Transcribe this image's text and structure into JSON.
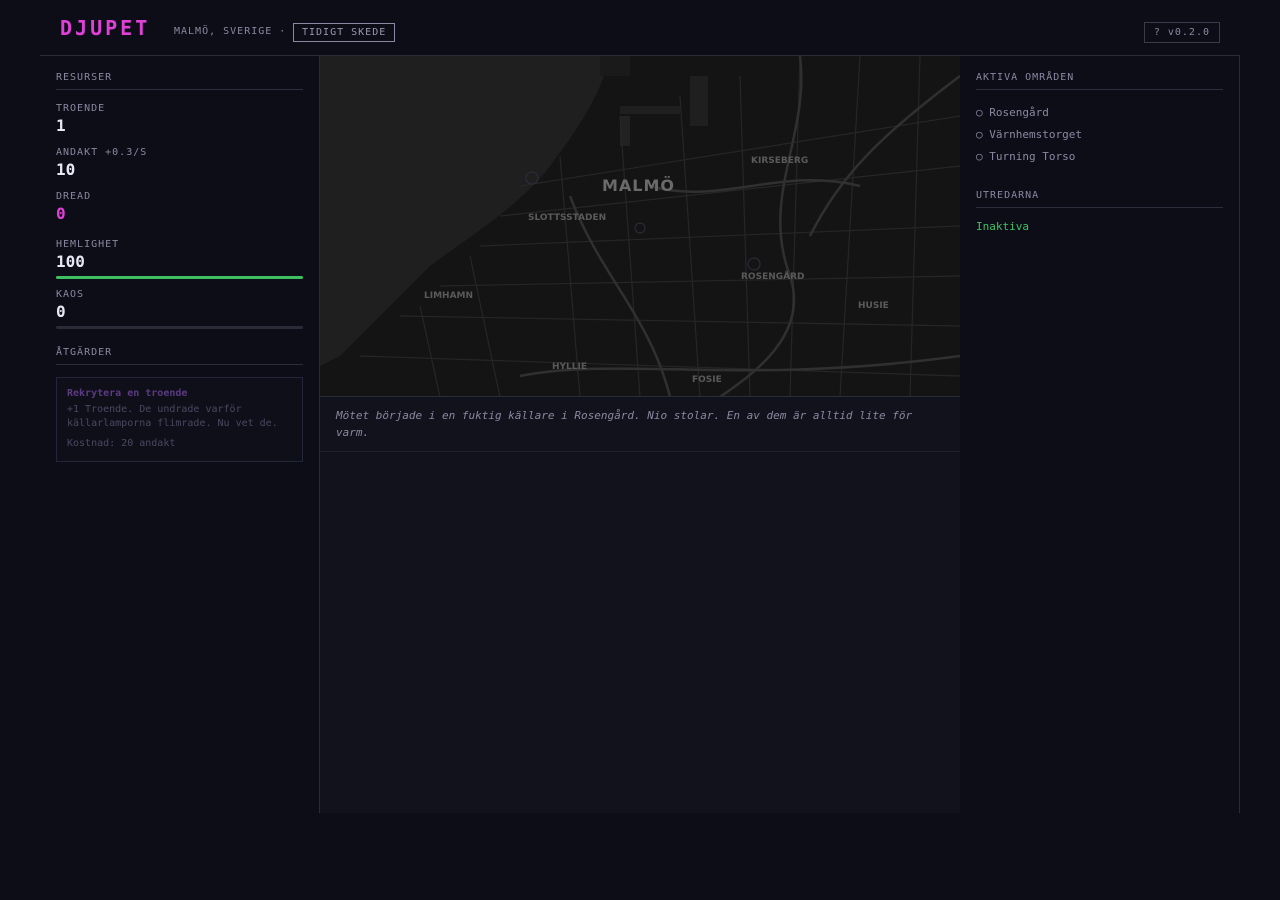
{
  "header": {
    "title": "DJUPET",
    "location": "MALMÖ, SVERIGE ·",
    "phase": "TIDIGT SKEDE",
    "version_button": "? v0.2.0"
  },
  "resources": {
    "title": "RESURSER",
    "troende": {
      "label": "TROENDE",
      "value": "1"
    },
    "andakt": {
      "label": "ANDAKT +0.3/S",
      "value": "10"
    },
    "dread": {
      "label": "DREAD",
      "value": "0"
    },
    "hemlighet": {
      "label": "HEMLIGHET",
      "value": "100",
      "bar_percent": 100
    },
    "kaos": {
      "label": "KAOS",
      "value": "0",
      "bar_percent": 0
    }
  },
  "actions": {
    "title": "ÅTGÄRDER",
    "items": [
      {
        "name": "Rekrytera en troende",
        "description": "+1 Troende. De undrade varför källarlamporna flimrade. Nu vet de.",
        "cost": "Kostnad: 20 andakt"
      }
    ]
  },
  "map": {
    "labels": {
      "malmo": "MALMÖ",
      "kirseberg": "KIRSEBERG",
      "slottsstaden": "SLOTTSSTADEN",
      "rosengard": "ROSENGÅRD",
      "limhamn": "LIMHAMN",
      "husie": "HUSIE",
      "hyllie": "HYLLIE",
      "fosie": "FOSIE"
    }
  },
  "log": {
    "entries": [
      "Mötet började i en fuktig källare i Rosengård. Nio stolar. En av dem är alltid lite för varm."
    ]
  },
  "areas": {
    "title": "AKTIVA OMRÅDEN",
    "items": [
      "○ Rosengård",
      "○ Värnhemstorget",
      "○ Turning Torso"
    ]
  },
  "investigators": {
    "title": "UTREDARNA",
    "status": "Inaktiva"
  },
  "colors": {
    "accent": "#e040d8",
    "ok": "#3fc060",
    "background": "#0d0d18"
  }
}
